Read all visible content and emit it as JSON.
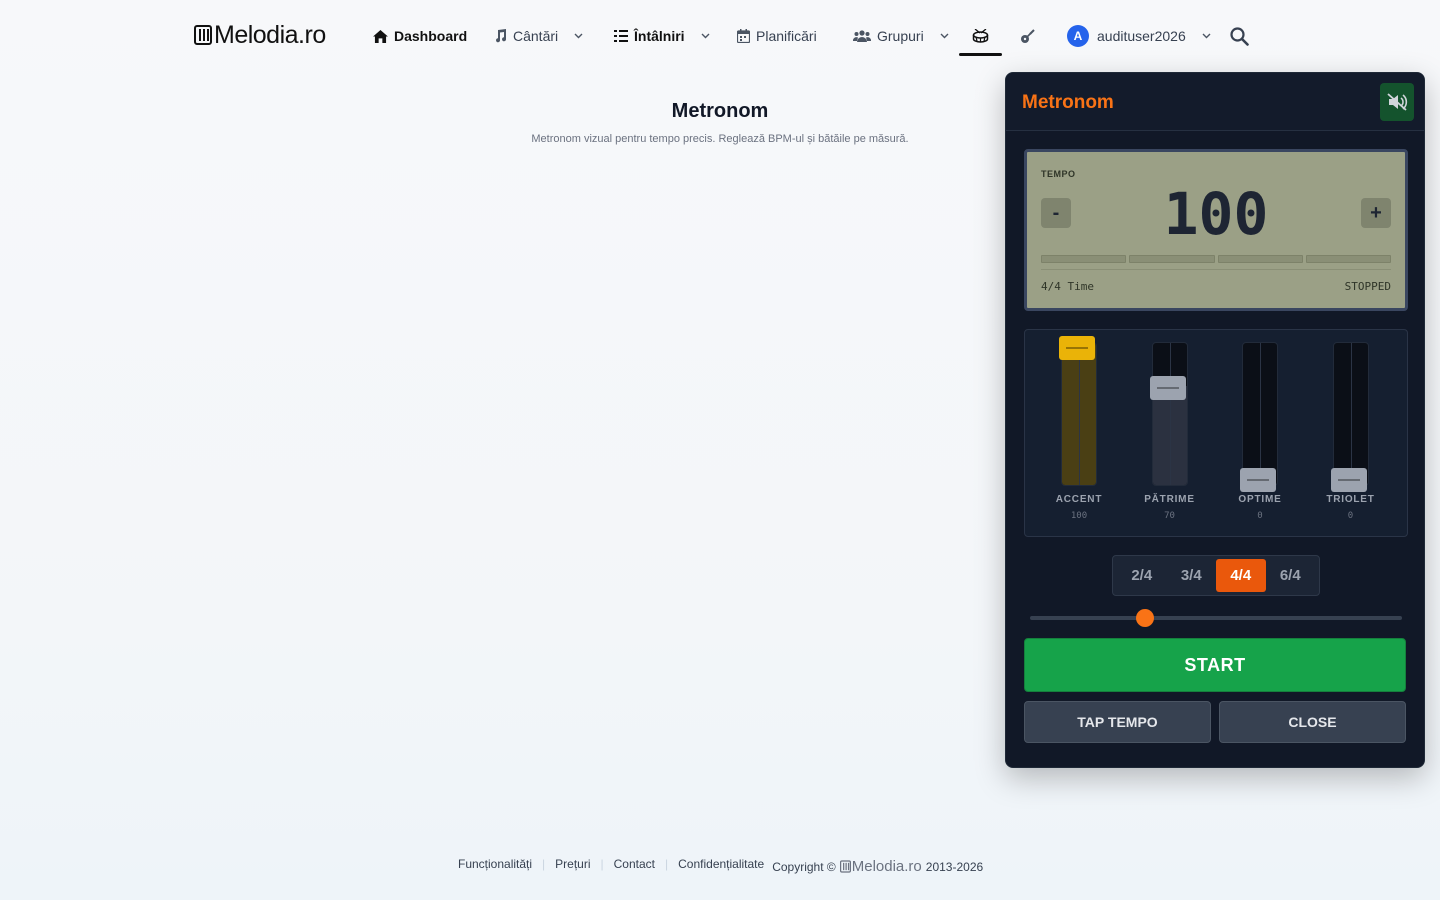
{
  "brand": {
    "logo_text": "Melodia.ro"
  },
  "nav": {
    "dashboard": "Dashboard",
    "cantari": "Cântări",
    "intalniri": "Întâlniri",
    "planificari": "Planificări",
    "grupuri": "Grupuri",
    "metronome_tab_icon": "drum-icon",
    "tuner_tab_icon": "guitar-icon",
    "user_initial": "A",
    "username": "audituser2026",
    "search_icon": "search-icon"
  },
  "page": {
    "title": "Metronom",
    "subtitle": "Metronom vizual pentru tempo precis. Reglează BPM-ul și bătăile pe măsură."
  },
  "metronome": {
    "title": "Metronom",
    "sound_icon": "speaker-off-icon",
    "tempo_label": "TEMPO",
    "bpm": "100",
    "minus": "-",
    "plus": "+",
    "time_label": "4/4 Time",
    "status": "STOPPED",
    "beats": 4,
    "mixer": [
      {
        "name": "ACCENT",
        "value": "100",
        "level": 1.0,
        "color": "#eab308",
        "fill": "#4a3f14"
      },
      {
        "name": "PĂTRIME",
        "value": "70",
        "level": 0.7,
        "color": "#9ca3af",
        "fill": "#2b3140"
      },
      {
        "name": "OPTIME",
        "value": "0",
        "level": 0.0,
        "color": "#9ca3af",
        "fill": "#2b3140"
      },
      {
        "name": "TRIOLET",
        "value": "0",
        "level": 0.0,
        "color": "#9ca3af",
        "fill": "#2b3140"
      }
    ],
    "time_signatures": [
      "2/4",
      "3/4",
      "4/4",
      "6/4"
    ],
    "active_time_signature": "4/4",
    "slider_fraction": 0.31,
    "start_label": "START",
    "tap_label": "TAP TEMPO",
    "close_label": "CLOSE"
  },
  "footer": {
    "links": [
      "Funcționalități",
      "Prețuri",
      "Contact",
      "Confidențialitate"
    ],
    "copyright_prefix": "Copyright ©",
    "copyright_brand": "Melodia.ro",
    "copyright_years": "2013-2026"
  },
  "colors": {
    "accent": "#f97316",
    "active_ts": "#ea580c",
    "start": "#16a34a",
    "lcd": "#9ba086",
    "panel": "#111827"
  }
}
